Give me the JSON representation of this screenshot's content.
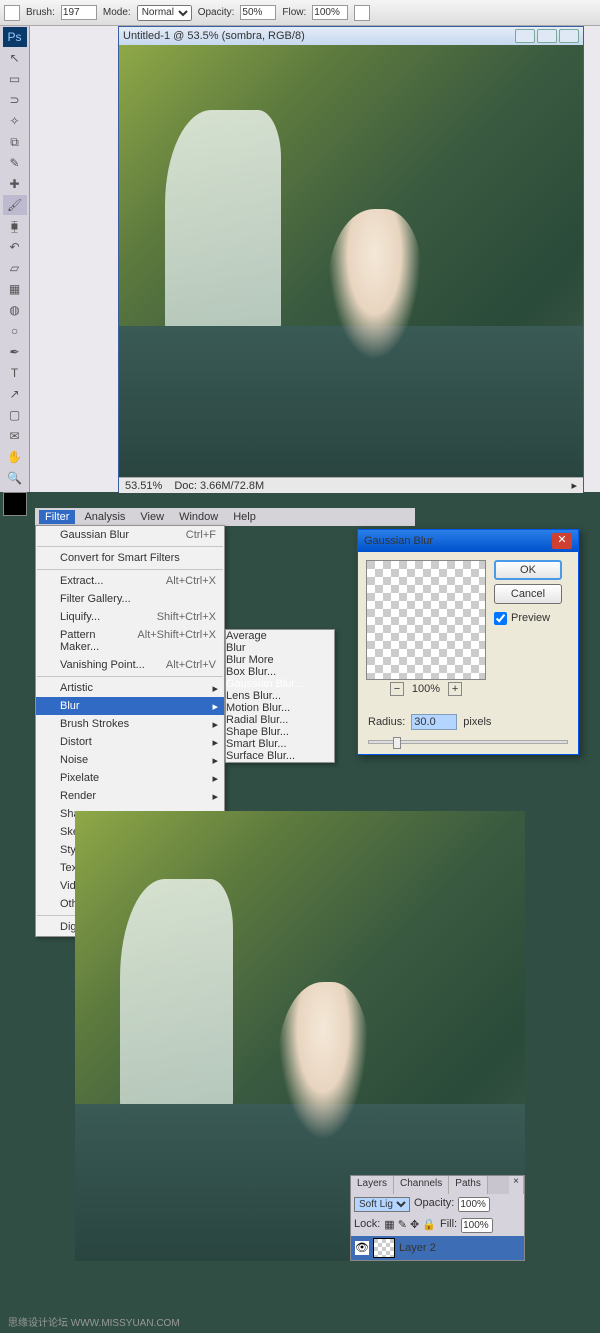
{
  "watermark": "思缘设计论坛  WWW.MISSYUAN.COM",
  "watermark2": "思缘设计论坛  WWW.MISSYUAN.COM",
  "optbar": {
    "brush_lbl": "Brush:",
    "brush_v": "197",
    "mode_lbl": "Mode:",
    "mode_v": "Normal",
    "opacity_lbl": "Opacity:",
    "opacity_v": "50%",
    "flow_lbl": "Flow:",
    "flow_v": "100%"
  },
  "doc": {
    "title": "Untitled-1 @ 53.5% (sombra, RGB/8)",
    "zoom": "53.51%",
    "docinfo": "Doc: 3.66M/72.8M"
  },
  "menubar": [
    "Filter",
    "Analysis",
    "View",
    "Window",
    "Help"
  ],
  "menu": {
    "top": [
      {
        "l": "Gaussian Blur",
        "sc": "Ctrl+F"
      },
      {
        "l": "Convert for Smart Filters"
      },
      {
        "l": "Extract...",
        "sc": "Alt+Ctrl+X"
      },
      {
        "l": "Filter Gallery..."
      },
      {
        "l": "Liquify...",
        "sc": "Shift+Ctrl+X"
      },
      {
        "l": "Pattern Maker...",
        "sc": "Alt+Shift+Ctrl+X"
      },
      {
        "l": "Vanishing Point...",
        "sc": "Alt+Ctrl+V"
      }
    ],
    "cats": [
      "Artistic",
      "Blur",
      "Brush Strokes",
      "Distort",
      "Noise",
      "Pixelate",
      "Render",
      "Sharpen",
      "Sketch",
      "Stylize",
      "Texture",
      "Video",
      "Other"
    ],
    "last": "Digimarc"
  },
  "submenu": [
    "Average",
    "Blur",
    "Blur More",
    "Box Blur...",
    "Gaussian Blur...",
    "Lens Blur...",
    "Motion Blur...",
    "Radial Blur...",
    "Shape Blur...",
    "Smart Blur...",
    "Surface Blur..."
  ],
  "dialog": {
    "title": "Gaussian Blur",
    "ok": "OK",
    "cancel": "Cancel",
    "preview": "Preview",
    "zoom": "100%",
    "radius_lbl": "Radius:",
    "radius_v": "30.0",
    "unit": "pixels"
  },
  "layers": {
    "tabs": [
      "Layers",
      "Channels",
      "Paths"
    ],
    "blend": "Soft Light",
    "op_lbl": "Opacity:",
    "op_v": "100%",
    "lock_lbl": "Lock:",
    "fill_lbl": "Fill:",
    "fill_v": "100%",
    "layer_name": "Layer 2"
  }
}
